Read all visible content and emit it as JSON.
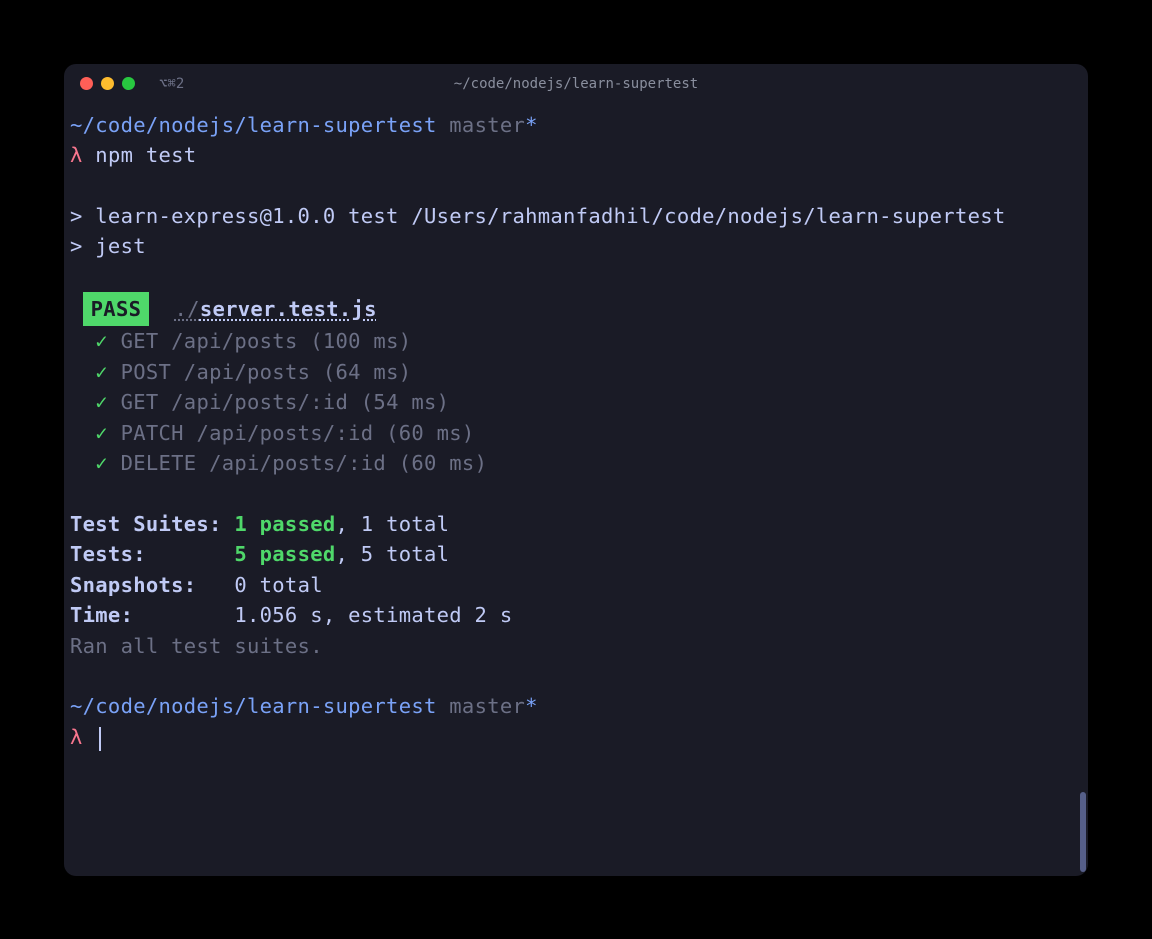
{
  "titlebar": {
    "tab_indicator": "⌥⌘2",
    "title": "~/code/nodejs/learn-supertest"
  },
  "prompt1": {
    "path": "~/code/nodejs/learn-supertest",
    "branch": "master",
    "asterisk": "*",
    "lambda": "λ",
    "command": " npm test"
  },
  "output": {
    "line1": "> learn-express@1.0.0 test /Users/rahmanfadhil/code/nodejs/learn-supertest",
    "line2": "> jest"
  },
  "pass": {
    "badge": "PASS",
    "prefix": "./",
    "file": "server.test.js"
  },
  "tests": [
    {
      "check": "✓",
      "desc": " GET /api/posts (100 ms)"
    },
    {
      "check": "✓",
      "desc": " POST /api/posts (64 ms)"
    },
    {
      "check": "✓",
      "desc": " GET /api/posts/:id (54 ms)"
    },
    {
      "check": "✓",
      "desc": " PATCH /api/posts/:id (60 ms)"
    },
    {
      "check": "✓",
      "desc": " DELETE /api/posts/:id (60 ms)"
    }
  ],
  "summary": {
    "suites_label": "Test Suites: ",
    "suites_passed": "1 passed",
    "suites_rest": ", 1 total",
    "tests_label": "Tests:       ",
    "tests_passed": "5 passed",
    "tests_rest": ", 5 total",
    "snapshots_label": "Snapshots:   ",
    "snapshots_value": "0 total",
    "time_label": "Time:        ",
    "time_value": "1.056 s, estimated 2 s",
    "ran": "Ran all test suites."
  },
  "prompt2": {
    "path": "~/code/nodejs/learn-supertest",
    "branch": "master",
    "asterisk": "*",
    "lambda": "λ"
  }
}
